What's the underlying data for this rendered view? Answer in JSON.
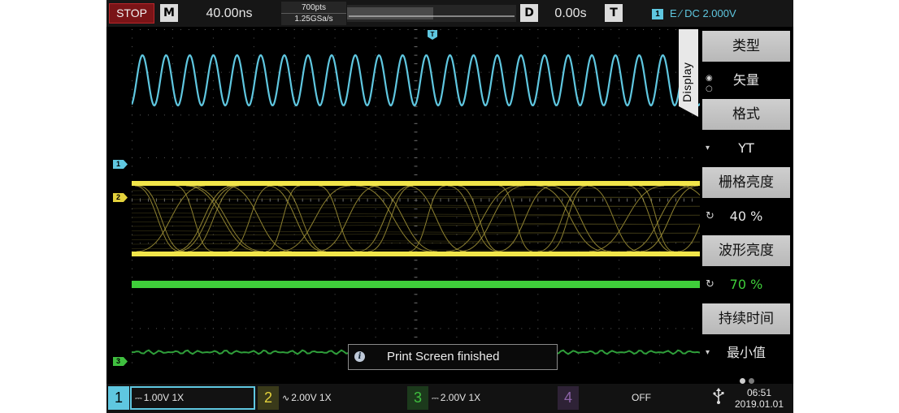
{
  "top_bar": {
    "run_state": "STOP",
    "mode_key": "M",
    "timebase": "40.00ns",
    "memory_depth": "700pts",
    "sample_rate": "1.25GSa/s",
    "delay_key": "D",
    "delay_value": "0.00s",
    "trigger_key": "T",
    "trigger_channel": "1",
    "trigger_info": "E ⁄ DC 2.000V"
  },
  "markers": {
    "trigger_pos": "T",
    "ch1": "1",
    "ch2": "2",
    "ch3": "3"
  },
  "side_menu": {
    "tab_label": "Display",
    "items": [
      {
        "label": "类型",
        "value": "矢量"
      },
      {
        "label": "格式",
        "value": "YT"
      },
      {
        "label": "栅格亮度",
        "value": "40 %"
      },
      {
        "label": "波形亮度",
        "value": "70 %"
      },
      {
        "label": "持续时间",
        "value": "最小值"
      }
    ]
  },
  "message": {
    "text": "Print Screen finished"
  },
  "channels": [
    {
      "number": "1",
      "coupling_glyph": "⎓",
      "scale": "1.00V 1X",
      "color": "#5fc7e0"
    },
    {
      "number": "2",
      "coupling_glyph": "∿",
      "scale": "2.00V 1X",
      "color": "#e3d13c"
    },
    {
      "number": "3",
      "coupling_glyph": "⎓",
      "scale": "2.00V 1X",
      "color": "#3fbf3f"
    },
    {
      "number": "4",
      "coupling_glyph": "",
      "scale": "OFF",
      "color": "#8c63a8"
    }
  ],
  "status": {
    "time": "06:51",
    "date": "2019.01.01"
  },
  "colors": {
    "ch1": "#5fc7e0",
    "ch2": "#e3d13c",
    "ch3": "#3fbf3f",
    "ch4": "#8c63a8",
    "stop": "#7a1417"
  },
  "icons": {
    "usb": "usb-icon",
    "info": "info-icon"
  }
}
